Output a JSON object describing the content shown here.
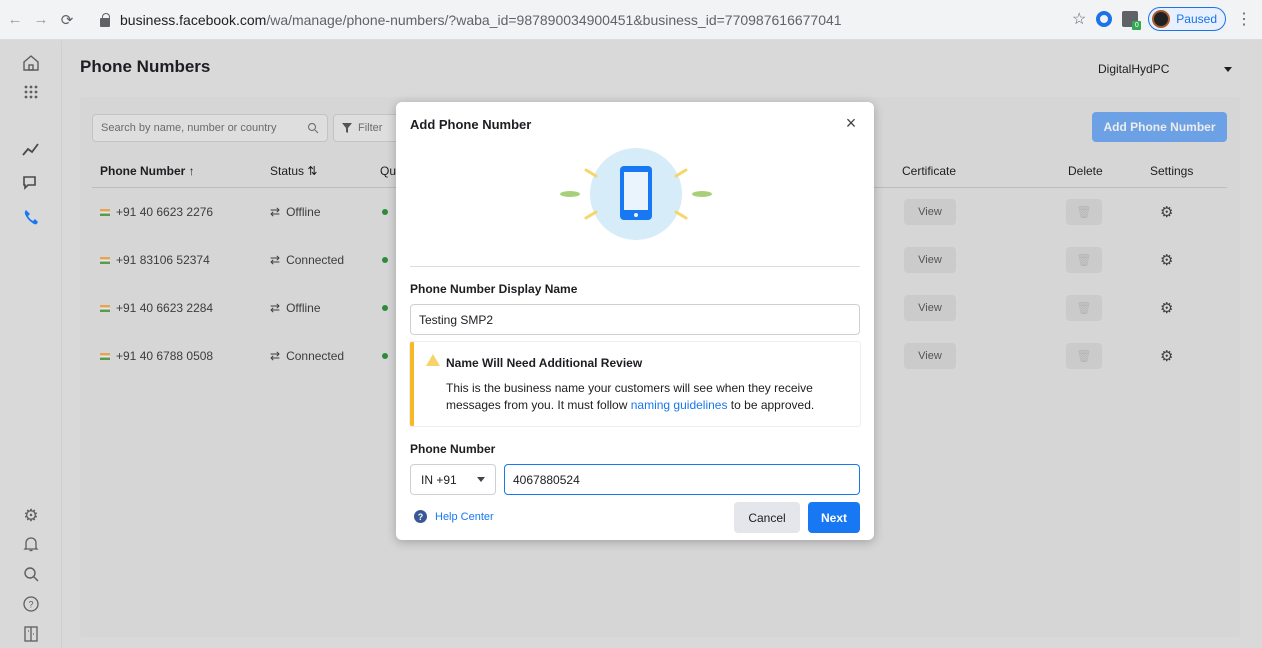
{
  "browser": {
    "back_icon": "arrow-left-icon",
    "forward_icon": "arrow-right-icon",
    "reload_icon": "reload-icon",
    "url_host": "business.facebook.com",
    "url_path": "/wa/manage/phone-numbers/?waba_id=987890034900451&business_id=770987616677041",
    "profile_status": "Paused"
  },
  "page": {
    "title": "Phone Numbers",
    "account": "DigitalHydPC",
    "search_placeholder": "Search by name, number or country",
    "filter_label": "Filter",
    "add_button": "Add Phone Number"
  },
  "table": {
    "columns": {
      "phone": "Phone Number ↑",
      "status": "Status ⇅",
      "quality": "Qu",
      "certificate": "Certificate",
      "delete": "Delete",
      "settings": "Settings"
    },
    "rows": [
      {
        "phone": "+91 40 6623 2276",
        "status": "Offline",
        "certificate": "View"
      },
      {
        "phone": "+91 83106 52374",
        "status": "Connected",
        "certificate": "View"
      },
      {
        "phone": "+91 40 6623 2284",
        "status": "Offline",
        "certificate": "View"
      },
      {
        "phone": "+91 40 6788 0508",
        "status": "Connected",
        "certificate": "View"
      }
    ]
  },
  "modal": {
    "title": "Add Phone Number",
    "display_name_label": "Phone Number Display Name",
    "display_name_value": "Testing SMP2",
    "warning_title": "Name Will Need Additional Review",
    "warning_text_1": "This is the business name your customers will see when they receive messages from you. It must follow ",
    "warning_link": "naming guidelines",
    "warning_text_2": " to be approved.",
    "phone_label": "Phone Number",
    "country_code": "IN +91",
    "phone_value": "4067880524",
    "help_label": "Help Center",
    "cancel": "Cancel",
    "next": "Next"
  },
  "colors": {
    "accent": "#1877f2",
    "warning": "#f7b928"
  }
}
